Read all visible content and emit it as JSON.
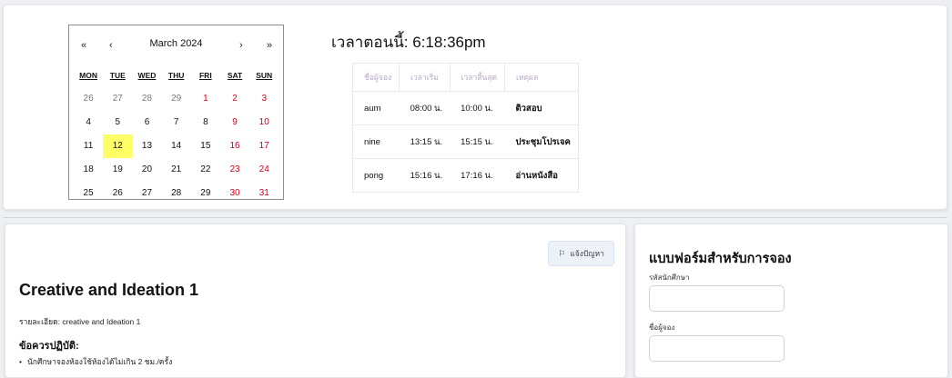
{
  "calendar": {
    "prev_year": "«",
    "prev_month": "‹",
    "title": "March 2024",
    "next_month": "›",
    "next_year": "»",
    "weekdays": [
      "MON",
      "TUE",
      "WED",
      "THU",
      "FRI",
      "SAT",
      "SUN"
    ],
    "weeks": [
      [
        {
          "d": "26",
          "t": "muted"
        },
        {
          "d": "27",
          "t": "muted"
        },
        {
          "d": "28",
          "t": "muted"
        },
        {
          "d": "29",
          "t": "muted"
        },
        {
          "d": "1",
          "t": "weekend-no"
        },
        {
          "d": "2",
          "t": "weekend"
        },
        {
          "d": "3",
          "t": "weekend"
        }
      ],
      [
        {
          "d": "4",
          "t": ""
        },
        {
          "d": "5",
          "t": ""
        },
        {
          "d": "6",
          "t": ""
        },
        {
          "d": "7",
          "t": ""
        },
        {
          "d": "8",
          "t": ""
        },
        {
          "d": "9",
          "t": "weekend"
        },
        {
          "d": "10",
          "t": "weekend"
        }
      ],
      [
        {
          "d": "11",
          "t": ""
        },
        {
          "d": "12",
          "t": "today"
        },
        {
          "d": "13",
          "t": ""
        },
        {
          "d": "14",
          "t": ""
        },
        {
          "d": "15",
          "t": ""
        },
        {
          "d": "16",
          "t": "weekend"
        },
        {
          "d": "17",
          "t": "weekend"
        }
      ],
      [
        {
          "d": "18",
          "t": ""
        },
        {
          "d": "19",
          "t": ""
        },
        {
          "d": "20",
          "t": ""
        },
        {
          "d": "21",
          "t": ""
        },
        {
          "d": "22",
          "t": ""
        },
        {
          "d": "23",
          "t": "weekend"
        },
        {
          "d": "24",
          "t": "weekend"
        }
      ],
      [
        {
          "d": "25",
          "t": ""
        },
        {
          "d": "26",
          "t": ""
        },
        {
          "d": "27",
          "t": ""
        },
        {
          "d": "28",
          "t": ""
        },
        {
          "d": "29",
          "t": ""
        },
        {
          "d": "30",
          "t": "weekend"
        },
        {
          "d": "31",
          "t": "weekend"
        }
      ]
    ]
  },
  "clock": {
    "label": "เวลาตอนนี้: 6:18:36pm"
  },
  "bookings": {
    "headers": [
      "ชื่อผู้จอง",
      "เวลาเริ่ม",
      "เวลาสิ้นสุด",
      "เหตุผล"
    ],
    "rows": [
      [
        "aum",
        "08:00 น.",
        "10:00 น.",
        "ติวสอบ"
      ],
      [
        "nine",
        "13:15 น.",
        "15:15 น.",
        "ประชุมโปรเจค"
      ],
      [
        "pong",
        "15:16 น.",
        "17:16 น.",
        "อ่านหนังสือ"
      ]
    ]
  },
  "detail": {
    "report_label": "แจ้งปัญหา",
    "report_icon": "flag-icon",
    "title": "Creative and Ideation 1",
    "description": "รายละเอียด: creative and Ideation 1",
    "rules_title": "ข้อควรปฏิบัติ:",
    "rules": [
      "นักศึกษาจองห้องใช้ห้องได้ไม่เกิน 2 ชม./ครั้ง"
    ]
  },
  "form": {
    "title": "แบบฟอร์มสำหรับการจอง",
    "student_id_label": "รหัสนักศึกษา",
    "student_id_value": "",
    "booker_label": "ชื่อผู้จอง",
    "booker_value": ""
  }
}
